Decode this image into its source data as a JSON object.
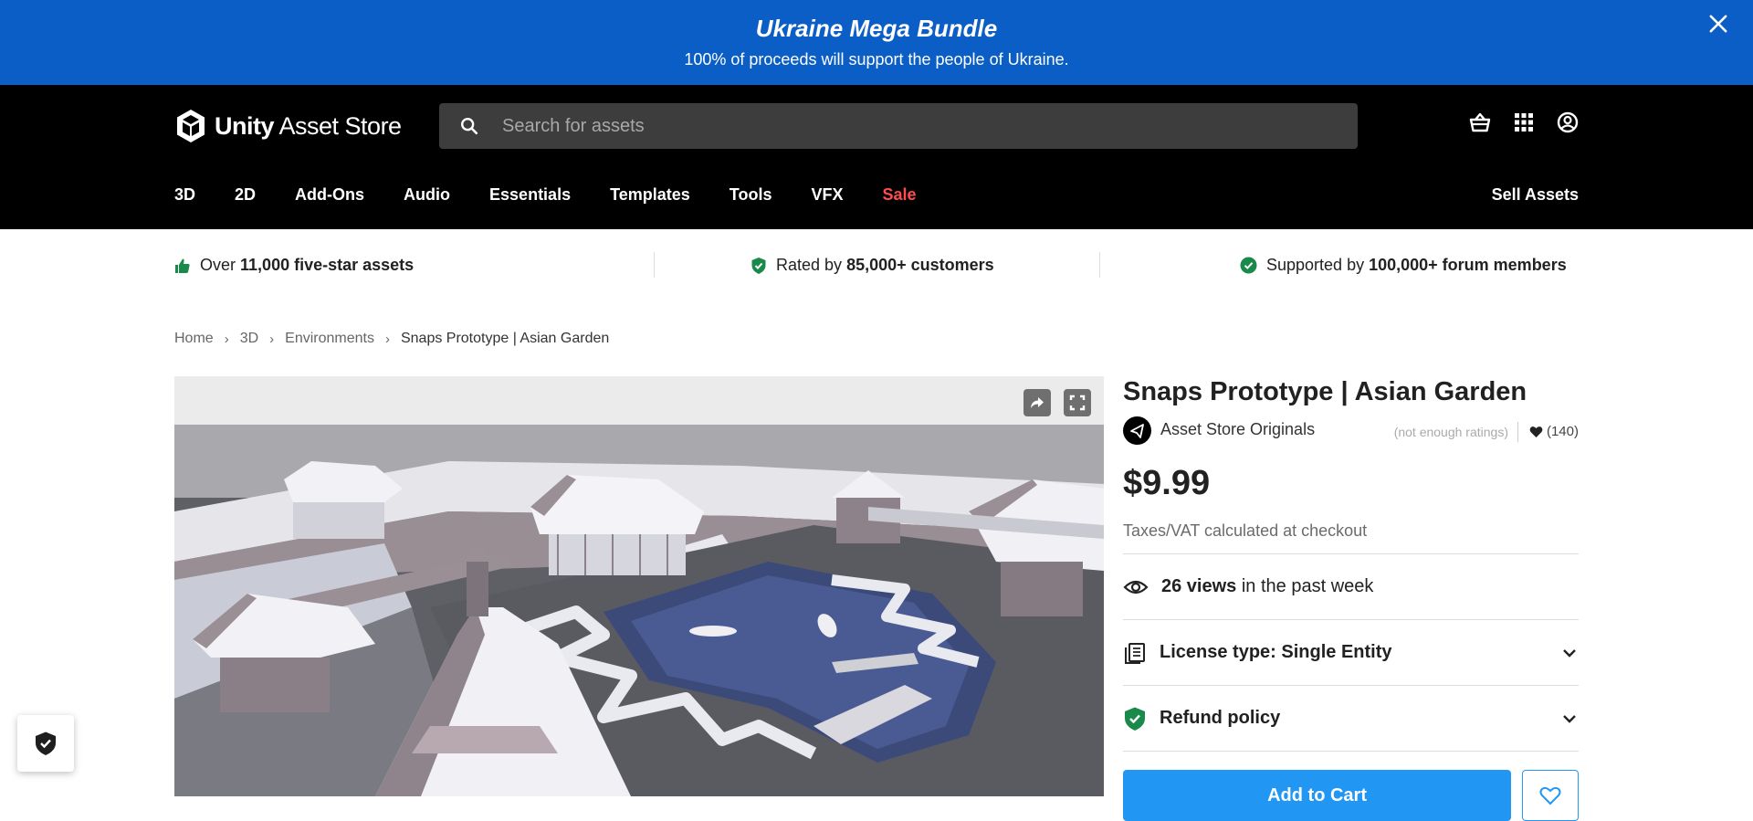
{
  "banner": {
    "title": "Ukraine Mega Bundle",
    "subtitle": "100% of proceeds will support the people of Ukraine."
  },
  "header": {
    "logo_bold": "Unity",
    "logo_rest": "Asset Store",
    "search_placeholder": "Search for assets",
    "nav": [
      "3D",
      "2D",
      "Add-Ons",
      "Audio",
      "Essentials",
      "Templates",
      "Tools",
      "VFX",
      "Sale"
    ],
    "sell_label": "Sell Assets"
  },
  "trust": {
    "item1_pre": "Over",
    "item1_bold": "11,000 five-star assets",
    "item2_pre": "Rated by",
    "item2_bold": "85,000+ customers",
    "item3_pre": "Supported by",
    "item3_bold": "100,000+ forum members"
  },
  "breadcrumb": [
    "Home",
    "3D",
    "Environments",
    "Snaps Prototype | Asian Garden"
  ],
  "product": {
    "title": "Snaps Prototype | Asian Garden",
    "publisher": "Asset Store Originals",
    "ratings_note": "(not enough ratings)",
    "favorites": "(140)",
    "price": "$9.99",
    "tax_note": "Taxes/VAT calculated at checkout",
    "views_bold": "26 views",
    "views_rest": "in the past week",
    "license": "License type: Single Entity",
    "refund": "Refund policy",
    "add_to_cart": "Add to Cart"
  },
  "colors": {
    "banner": "#0a5ec5",
    "header": "#000000",
    "sale": "#ff4d4d",
    "cta": "#2196f3",
    "trust_green": "#1a8a4a"
  }
}
